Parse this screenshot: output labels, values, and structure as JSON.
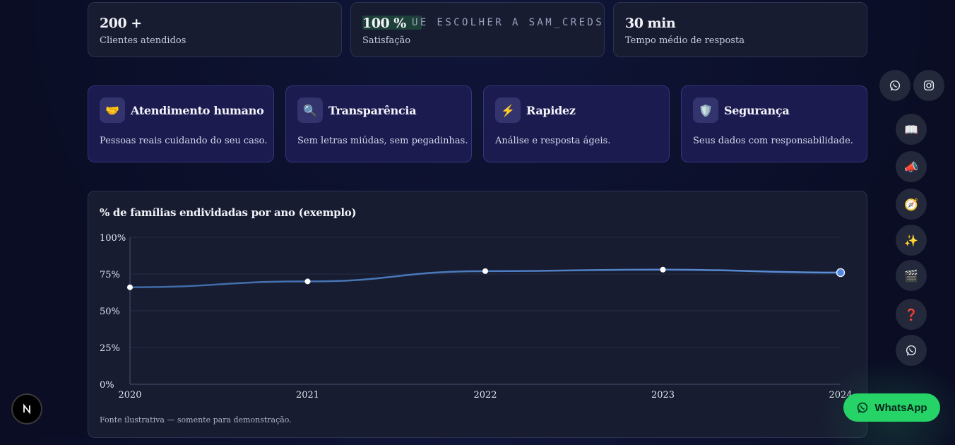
{
  "stats": [
    {
      "value": "200 +",
      "label": "Clientes atendidos"
    },
    {
      "value": "100 %",
      "label": "Satisfação",
      "overlay": "UE ESCOLHER A SAM_CREDS"
    },
    {
      "value": "30 min",
      "label": "Tempo médio de resposta"
    }
  ],
  "features": [
    {
      "icon": "handshake-icon",
      "title": "Atendimento humano",
      "desc": "Pessoas reais cuidando do seu caso."
    },
    {
      "icon": "magnifier-icon",
      "title": "Transparência",
      "desc": "Sem letras miúdas, sem pegadinhas."
    },
    {
      "icon": "lightning-icon",
      "title": "Rapidez",
      "desc": "Análise e resposta ágeis."
    },
    {
      "icon": "shield-icon",
      "title": "Segurança",
      "desc": "Seus dados com responsabilidade."
    }
  ],
  "chart": {
    "title": "% de famílias endividadas por ano (exemplo)",
    "source": "Fonte ilustrativa — somente para demonstração."
  },
  "chart_data": {
    "type": "line",
    "title": "% de famílias endividadas por ano (exemplo)",
    "x": [
      "2020",
      "2021",
      "2022",
      "2023",
      "2024"
    ],
    "y_ticks": [
      "0%",
      "25%",
      "50%",
      "75%",
      "100%"
    ],
    "ylim": [
      0,
      100
    ],
    "series": [
      {
        "values": [
          66,
          70,
          77,
          78,
          76
        ]
      }
    ],
    "grid": true,
    "line_color": "#5b8fd8",
    "highlight_point_color": "#4f86e0"
  },
  "social": [
    {
      "icon": "whatsapp-icon"
    },
    {
      "icon": "instagram-icon"
    }
  ],
  "side_nav": [
    {
      "icon": "book-icon"
    },
    {
      "icon": "megaphone-icon"
    },
    {
      "icon": "compass-icon"
    },
    {
      "icon": "sparkles-icon"
    },
    {
      "icon": "clapperboard-icon"
    },
    {
      "icon": "question-icon"
    },
    {
      "icon": "whatsapp-icon"
    }
  ],
  "whatsapp_cta": {
    "label": "WhatsApp",
    "color": "#25d366"
  },
  "nextjs_badge": {
    "letter": "N"
  }
}
